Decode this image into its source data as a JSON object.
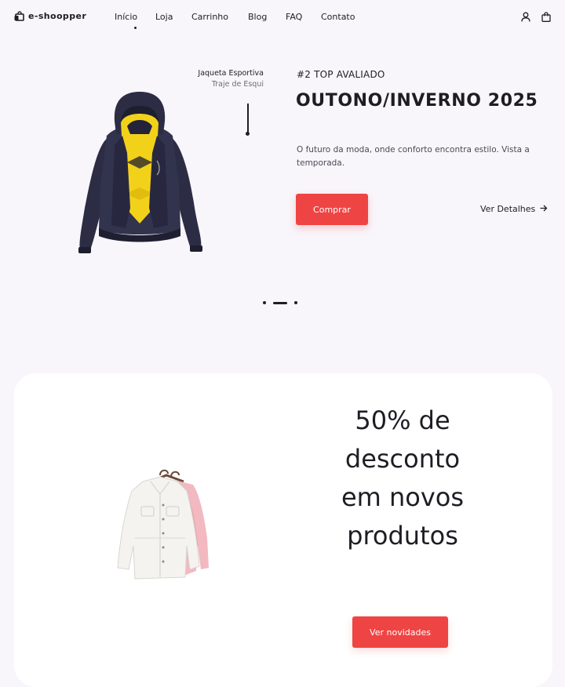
{
  "header": {
    "logo_text": "e-shoopper",
    "nav": [
      "Início",
      "Loja",
      "Carrinho",
      "Blog",
      "FAQ",
      "Contato"
    ],
    "active_nav": "Início"
  },
  "hero": {
    "product_name": "Jaqueta Esportiva",
    "product_subtitle": "Traje de Esqui",
    "eyebrow": "#2 TOP AVALIADO",
    "title": "OUTONO/INVERNO 2025",
    "description": "O futuro da moda, onde conforto encontra estilo. Vista a temporada.",
    "buy_label": "Comprar",
    "details_label": "Ver Detalhes",
    "slide_count": 3,
    "active_slide": 2
  },
  "promo": {
    "title": "50% de desconto em novos produtos",
    "button_label": "Ver novidades"
  },
  "colors": {
    "accent": "#ef4444",
    "background": "#f8f6fb",
    "card": "#ffffff",
    "text": "#1f1d24"
  }
}
